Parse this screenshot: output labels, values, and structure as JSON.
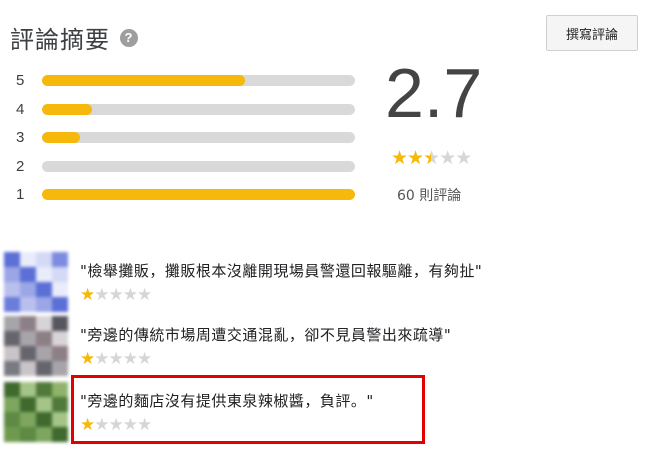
{
  "header": {
    "title": "評論摘要",
    "help_icon": "question-circle-icon",
    "write_button": "撰寫評論"
  },
  "summary": {
    "score": "2.7",
    "score_value": 2.7,
    "review_count": "60 則評論",
    "distribution": [
      {
        "label": "5",
        "fraction": 0.65
      },
      {
        "label": "4",
        "fraction": 0.16
      },
      {
        "label": "3",
        "fraction": 0.12
      },
      {
        "label": "2",
        "fraction": 0.0
      },
      {
        "label": "1",
        "fraction": 1.0
      }
    ]
  },
  "reviews": [
    {
      "text": "\"檢舉攤販，攤販根本沒離開現場員警還回報驅離，有夠扯\"",
      "stars": 1,
      "avatar": "blurred-avatar-blue"
    },
    {
      "text": "\"旁邊的傳統市場周遭交通混亂，卻不見員警出來疏導\"",
      "stars": 1,
      "avatar": "blurred-avatar-gray"
    },
    {
      "text": "\"旁邊的麵店沒有提供東泉辣椒醬，負評。\"",
      "stars": 1,
      "avatar": "blurred-avatar-green"
    }
  ],
  "colors": {
    "star": "#f6b80a",
    "highlight": "#e30000",
    "bar_track": "#d9d9d9"
  }
}
